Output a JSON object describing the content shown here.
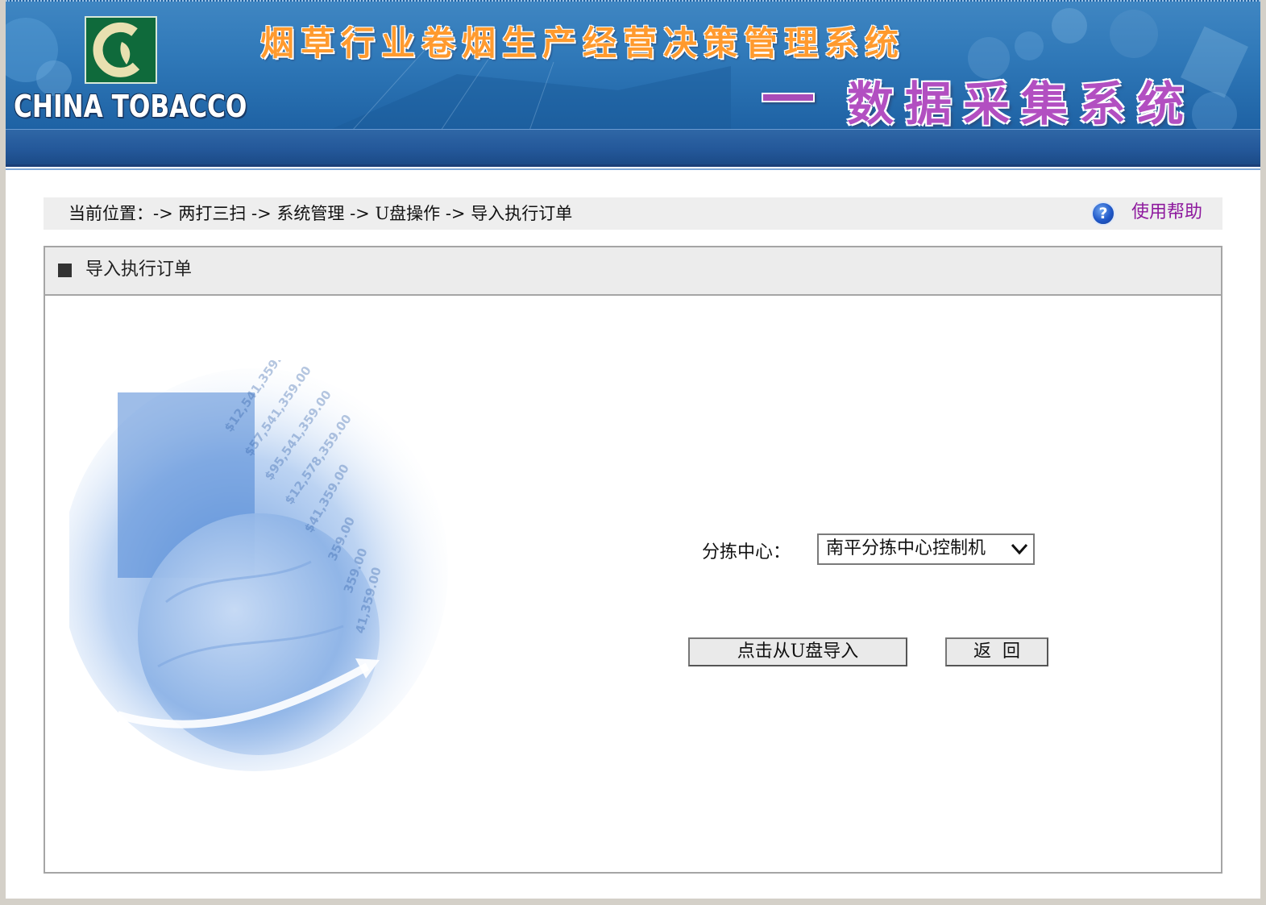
{
  "banner": {
    "logo_text": "CHINA TOBACCO",
    "title": "烟草行业卷烟生产经营决策管理系统",
    "subtitle": "数据采集系统"
  },
  "breadcrumb": {
    "text": "当前位置：-> 两打三扫 -> 系统管理 -> U盘操作 -> 导入执行订单",
    "help_label": "使用帮助"
  },
  "panel": {
    "title": "导入执行订单"
  },
  "form": {
    "center_label": "分拣中心：",
    "center_selected": "南平分拣中心控制机",
    "import_button": "点击从U盘导入",
    "back_button": "返  回"
  },
  "colors": {
    "banner_blue": "#2f78b8",
    "help_link": "#8e1a9e",
    "title_orange": "#ff9a2e",
    "subtitle_purple": "#b24fc1"
  },
  "icons": {
    "logo": "china-tobacco-logo-icon",
    "help": "help-question-icon",
    "select_arrow": "chevron-down-icon"
  }
}
